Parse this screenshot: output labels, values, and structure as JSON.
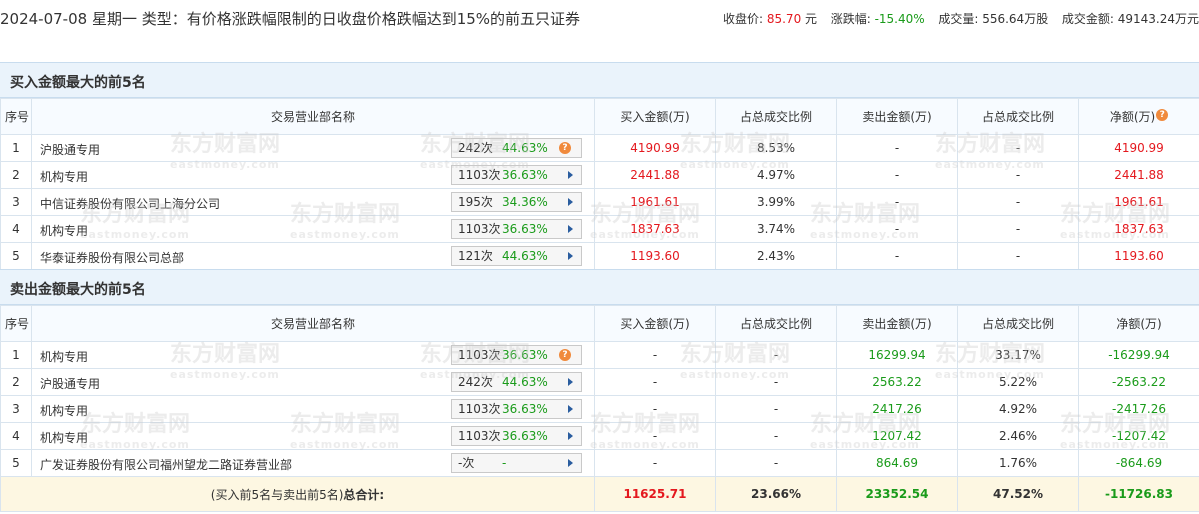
{
  "header": {
    "title": "2024-07-08 星期一 类型：有价格涨跌幅限制的日收盘价格跌幅达到15%的前五只证券",
    "close_label": "收盘价:",
    "close_value": "85.70",
    "close_unit": "元",
    "change_label": "涨跌幅:",
    "change_value": "-15.40%",
    "volume_label": "成交量:",
    "volume_value": "556.64万股",
    "amount_label": "成交金额:",
    "amount_value": "49143.24万元"
  },
  "columns": {
    "seq": "序号",
    "dept": "交易营业部名称",
    "buy_amt": "买入金额(万)",
    "buy_ratio": "占总成交比例",
    "sell_amt": "卖出金额(万)",
    "sell_ratio": "占总成交比例",
    "net": "净额(万)",
    "help_icon": "?"
  },
  "buy_section": {
    "title": "买入金额最大的前5名",
    "rows": [
      {
        "seq": "1",
        "name": "沪股通专用",
        "times": "242次",
        "pct": "44.63%",
        "icon": "help-icon",
        "buy": "4190.99",
        "buy_ratio": "8.53%",
        "sell": "-",
        "sell_ratio": "-",
        "net": "4190.99"
      },
      {
        "seq": "2",
        "name": "机构专用",
        "times": "1103次",
        "pct": "36.63%",
        "icon": "play-arrow-icon",
        "buy": "2441.88",
        "buy_ratio": "4.97%",
        "sell": "-",
        "sell_ratio": "-",
        "net": "2441.88"
      },
      {
        "seq": "3",
        "name": "中信证券股份有限公司上海分公司",
        "times": "195次",
        "pct": "34.36%",
        "icon": "play-arrow-icon",
        "buy": "1961.61",
        "buy_ratio": "3.99%",
        "sell": "-",
        "sell_ratio": "-",
        "net": "1961.61"
      },
      {
        "seq": "4",
        "name": "机构专用",
        "times": "1103次",
        "pct": "36.63%",
        "icon": "play-arrow-icon",
        "buy": "1837.63",
        "buy_ratio": "3.74%",
        "sell": "-",
        "sell_ratio": "-",
        "net": "1837.63"
      },
      {
        "seq": "5",
        "name": "华泰证券股份有限公司总部",
        "times": "121次",
        "pct": "44.63%",
        "icon": "play-arrow-icon",
        "buy": "1193.60",
        "buy_ratio": "2.43%",
        "sell": "-",
        "sell_ratio": "-",
        "net": "1193.60"
      }
    ]
  },
  "sell_section": {
    "title": "卖出金额最大的前5名",
    "rows": [
      {
        "seq": "1",
        "name": "机构专用",
        "times": "1103次",
        "pct": "36.63%",
        "icon": "help-icon",
        "buy": "-",
        "buy_ratio": "-",
        "sell": "16299.94",
        "sell_ratio": "33.17%",
        "net": "-16299.94"
      },
      {
        "seq": "2",
        "name": "沪股通专用",
        "times": "242次",
        "pct": "44.63%",
        "icon": "play-arrow-icon",
        "buy": "-",
        "buy_ratio": "-",
        "sell": "2563.22",
        "sell_ratio": "5.22%",
        "net": "-2563.22"
      },
      {
        "seq": "3",
        "name": "机构专用",
        "times": "1103次",
        "pct": "36.63%",
        "icon": "play-arrow-icon",
        "buy": "-",
        "buy_ratio": "-",
        "sell": "2417.26",
        "sell_ratio": "4.92%",
        "net": "-2417.26"
      },
      {
        "seq": "4",
        "name": "机构专用",
        "times": "1103次",
        "pct": "36.63%",
        "icon": "play-arrow-icon",
        "buy": "-",
        "buy_ratio": "-",
        "sell": "1207.42",
        "sell_ratio": "2.46%",
        "net": "-1207.42"
      },
      {
        "seq": "5",
        "name": "广发证券股份有限公司福州望龙二路证券营业部",
        "times": "-次",
        "pct": "-",
        "icon": "play-arrow-icon",
        "buy": "-",
        "buy_ratio": "-",
        "sell": "864.69",
        "sell_ratio": "1.76%",
        "net": "-864.69"
      }
    ]
  },
  "total": {
    "label_prefix": "(买入前5名与卖出前5名)",
    "label_bold": "总合计:",
    "buy": "11625.71",
    "buy_ratio": "23.66%",
    "sell": "23352.54",
    "sell_ratio": "47.52%",
    "net": "-11726.83"
  },
  "watermark": {
    "brand": "东方财富网",
    "domain": "eastmoney.com"
  },
  "colors": {
    "red": "#e4181e",
    "green": "#1a9b1a",
    "section_bg": "#eaf3fb",
    "total_bg": "#fdf7e2",
    "help_icon": "#f08a3c",
    "arrow": "#2a5d9f"
  }
}
